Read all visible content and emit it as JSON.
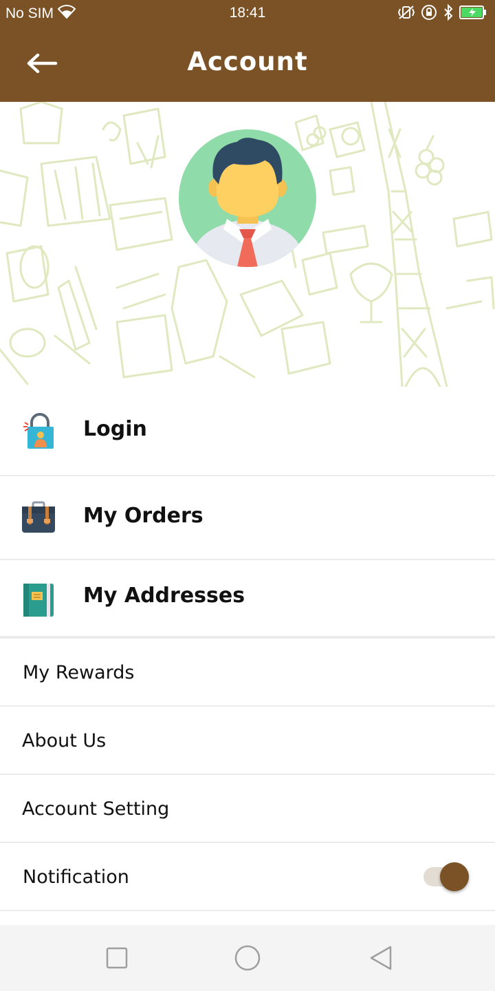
{
  "status_bar": {
    "carrier": "No SIM",
    "time": "18:41",
    "icons": [
      "wifi-icon",
      "vibrate-icon",
      "rotation-lock-icon",
      "bluetooth-icon",
      "battery-charging-icon"
    ]
  },
  "app_bar": {
    "title": "Account",
    "back_icon": "arrow-left-icon"
  },
  "profile": {
    "avatar_icon": "user-avatar-icon"
  },
  "menu": {
    "primary_items": [
      {
        "label": "Login",
        "icon": "padlock-user-icon"
      },
      {
        "label": "My Orders",
        "icon": "briefcase-icon"
      },
      {
        "label": "My Addresses",
        "icon": "address-book-icon"
      }
    ],
    "secondary_items": [
      {
        "label": "My Rewards"
      },
      {
        "label": "About Us"
      },
      {
        "label": "Account Setting"
      },
      {
        "label": "Notification",
        "toggle_on": true
      }
    ]
  },
  "nav_bar": {
    "buttons": [
      "recents-square-icon",
      "home-circle-icon",
      "back-triangle-icon"
    ]
  },
  "colors": {
    "primary_brown": "#7b5226",
    "pattern_green": "#dfe8bf",
    "avatar_bg": "#8fdcaa"
  }
}
